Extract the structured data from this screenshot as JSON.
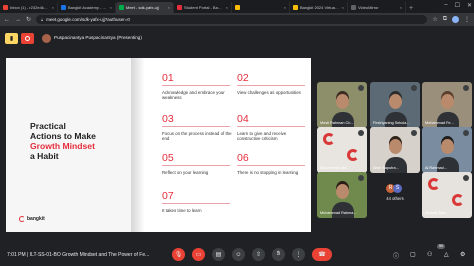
{
  "browser": {
    "tabs": [
      {
        "label": "Inbox (1) - r232e4ky1963@",
        "color": "#ea4335",
        "active": false
      },
      {
        "label": "Bangkit Academy - Calendar",
        "color": "#1a73e8",
        "active": false
      },
      {
        "label": "Meet - sdk-yafx-ujj",
        "color": "#00ac47",
        "active": true
      },
      {
        "label": "Student Portal - Bangkit",
        "color": "#e52d3c",
        "active": false
      },
      {
        "label": "",
        "color": "#fbbc04",
        "active": false
      },
      {
        "label": "Bangkit 2024 Virtual Back",
        "color": "#fbbc04",
        "active": false
      },
      {
        "label": "VideoMirror",
        "color": "#5f6368",
        "active": false
      }
    ],
    "url": "meet.google.com/sdk-yafx-ujj?authuser=0"
  },
  "meet": {
    "presenting_label": "Puspacinantya Puspacinantya (Presenting)",
    "time": "7:01 PM",
    "meeting_title": "ILT-SS-01-BO Growth Mindset and The Power of Fe...",
    "participant_count_badge": "50"
  },
  "slide": {
    "title_line1": "Practical",
    "title_line2": "Actions to Make",
    "title_highlight": "Growth Mindset",
    "title_line4": "a Habit",
    "logo_text": "bangkit",
    "items": [
      {
        "num": "01",
        "text": "Acknowledge and embrace your weakness"
      },
      {
        "num": "02",
        "text": "View challenges as opportunities"
      },
      {
        "num": "03",
        "text": "Focus on the process instead of the end"
      },
      {
        "num": "04",
        "text": "Learn to give and receive constructive criticism"
      },
      {
        "num": "05",
        "text": "Reflect on your learning"
      },
      {
        "num": "06",
        "text": "There is no stopping in learning"
      },
      {
        "num": "07",
        "text": "It takes time to learn"
      }
    ]
  },
  "participants": [
    {
      "name": "Mesti Rahman Ch...",
      "bg": "#8c8f6a"
    },
    {
      "name": "Firstriyaning Sekola...",
      "bg": "#5b6a74"
    },
    {
      "name": "Muhammad Fe...",
      "bg": "#9a8f7a"
    },
    {
      "name": "Muhammad Ma...",
      "bg": "#e8e4e0"
    },
    {
      "name": "Alvin Saputra...",
      "bg": "#d7d1cb"
    },
    {
      "name": "Al Rahmad...",
      "bg": "#7a8da0"
    },
    {
      "name": "Muhammad Rahma...",
      "bg": "#6f8a4c"
    },
    {
      "name": "Ahmad Zaki...",
      "bg": "#e6e2de"
    }
  ],
  "others": {
    "label": "44 others",
    "avatars": [
      {
        "letter": "R",
        "color": "#c8643b"
      },
      {
        "letter": "S",
        "color": "#5c6bc0"
      }
    ]
  }
}
